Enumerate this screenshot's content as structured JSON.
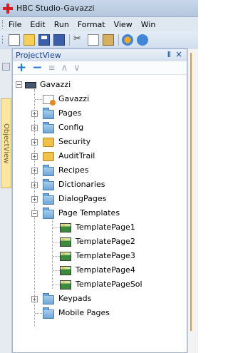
{
  "window": {
    "title": "HBC Studio-Gavazzi"
  },
  "menu": {
    "items": [
      "File",
      "Edit",
      "Run",
      "Format",
      "View",
      "Win"
    ]
  },
  "toolbar": {
    "icons": [
      "new-file-icon",
      "open-folder-icon",
      "save-icon",
      "save-all-icon",
      "cut-icon",
      "copy-icon",
      "paste-icon",
      "component-icon",
      "run-icon"
    ]
  },
  "side_tabs": {
    "object_view": "ObjectView"
  },
  "panel": {
    "title": "ProjectView",
    "pin_glyph": "Ⅱ",
    "close_glyph": "×"
  },
  "panel_toolbar": {
    "add_glyph": "+",
    "remove_glyph": "−",
    "list_glyph": "≡",
    "up_glyph": "∧",
    "down_glyph": "∨"
  },
  "tree": {
    "root": {
      "label": "Gavazzi",
      "expanded": true
    },
    "items": [
      {
        "label": "Gavazzi",
        "icon": "project-file-icon",
        "expander": false
      },
      {
        "label": "Pages",
        "icon": "folder-icon",
        "expander": true,
        "expanded": false
      },
      {
        "label": "Config",
        "icon": "folder-icon",
        "expander": true,
        "expanded": false
      },
      {
        "label": "Security",
        "icon": "lock-icon",
        "expander": true,
        "expanded": false
      },
      {
        "label": "AuditTrail",
        "icon": "lock-icon",
        "expander": true,
        "expanded": false
      },
      {
        "label": "Recipes",
        "icon": "folder-icon",
        "expander": true,
        "expanded": false
      },
      {
        "label": "Dictionaries",
        "icon": "folder-icon",
        "expander": true,
        "expanded": false
      },
      {
        "label": "DialogPages",
        "icon": "folder-icon",
        "expander": true,
        "expanded": false
      },
      {
        "label": "Page Templates",
        "icon": "folder-icon",
        "expander": true,
        "expanded": true,
        "children": [
          "TemplatePage1",
          "TemplatePage2",
          "TemplatePage3",
          "TemplatePage4",
          "TemplatePageSol"
        ]
      },
      {
        "label": "Keypads",
        "icon": "folder-icon",
        "expander": true,
        "expanded": false
      },
      {
        "label": "Mobile Pages",
        "icon": "folder-icon",
        "expander": false
      }
    ],
    "expander_collapsed": "+",
    "expander_expanded": "−"
  }
}
